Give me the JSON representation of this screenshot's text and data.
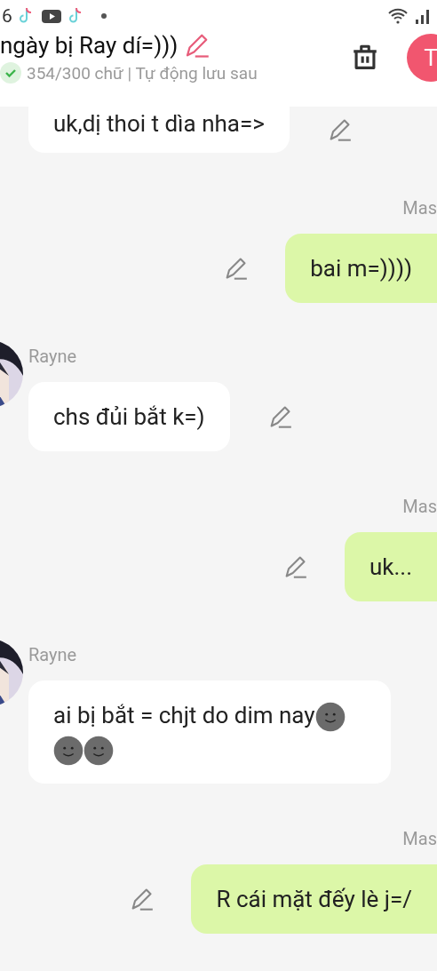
{
  "status_bar": {
    "time": "6",
    "app_icons": [
      {
        "kind": "tiktok"
      },
      {
        "kind": "youtube"
      },
      {
        "kind": "tiktok"
      },
      {
        "kind": "dot"
      }
    ]
  },
  "header": {
    "title": "ngày bị Ray dí=)))",
    "saved": true,
    "stats": "354/300 chữ | Tự động lưu sau",
    "avatar_letter": "T"
  },
  "messages": [
    {
      "kind": "received",
      "editable": true,
      "text": "uk,dị thoi t dìa nha=>"
    },
    {
      "kind": "sent",
      "editable": true,
      "sender": "Mas",
      "text": "bai m=))))"
    },
    {
      "kind": "received",
      "editable": true,
      "sender": "Rayne",
      "avatar": true,
      "text": "chs đủi bắt k=)"
    },
    {
      "kind": "sent",
      "editable": true,
      "sender": "Mas",
      "text": "uk..."
    },
    {
      "kind": "received",
      "sender": "Rayne",
      "avatar": true,
      "text": "ai bị bắt = chjt do dim nay",
      "icons": [
        {
          "kind": "moon-face"
        },
        {
          "kind": "moon-face"
        },
        {
          "kind": "moon-face"
        }
      ]
    },
    {
      "kind": "sent",
      "editable": true,
      "sender": "Mas",
      "text": "R cái mặt đếy lè j=/"
    }
  ]
}
